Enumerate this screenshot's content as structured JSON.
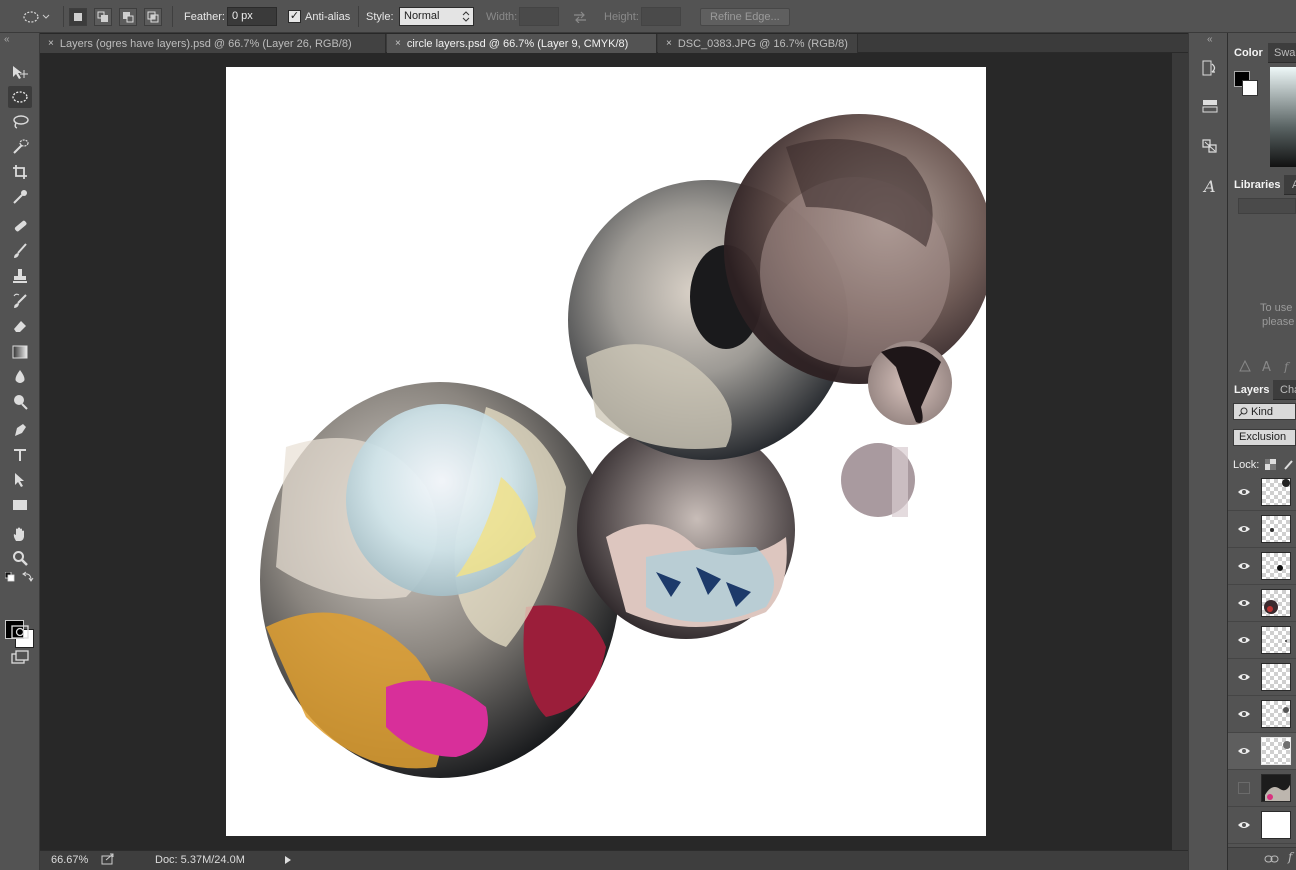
{
  "options_bar": {
    "feather_label": "Feather:",
    "feather_value": "0 px",
    "antialias_label": "Anti-alias",
    "style_label": "Style:",
    "style_value": "Normal",
    "width_label": "Width:",
    "height_label": "Height:",
    "refine_edge_label": "Refine Edge..."
  },
  "tabs": [
    {
      "label": "Layers (ogres have layers).psd @ 66.7% (Layer 26, RGB/8)",
      "active": false
    },
    {
      "label": "circle layers.psd @ 66.7% (Layer 9, CMYK/8)",
      "active": true
    },
    {
      "label": "DSC_0383.JPG @ 16.7% (RGB/8)",
      "active": false
    }
  ],
  "tab_close_glyph": "×",
  "collapse_glyph": "«",
  "status_bar": {
    "zoom": "66.67%",
    "doc": "Doc: 5.37M/24.0M"
  },
  "panels": {
    "color_tab": "Color",
    "swatches_tab": "Swa",
    "libraries_tab": "Libraries",
    "libraries_tab2": "A",
    "libraries_hint_1": "To use",
    "libraries_hint_2": "please",
    "layers_tab": "Layers",
    "channels_tab": "Cha",
    "filter_kind": "Kind",
    "blend_mode": "Exclusion",
    "lock_label": "Lock:"
  },
  "layers": [
    {
      "thumb": "transparent",
      "visible": true,
      "selected": false
    },
    {
      "thumb": "transparent",
      "visible": true,
      "selected": false
    },
    {
      "thumb": "transparent",
      "visible": true,
      "selected": false
    },
    {
      "thumb": "transparent",
      "visible": true,
      "selected": false
    },
    {
      "thumb": "transparent",
      "visible": true,
      "selected": false
    },
    {
      "thumb": "transparent",
      "visible": true,
      "selected": false
    },
    {
      "thumb": "transparent",
      "visible": true,
      "selected": false
    },
    {
      "thumb": "transparent",
      "visible": true,
      "selected": true
    },
    {
      "thumb": "photo",
      "visible": false,
      "selected": false
    },
    {
      "thumb": "white",
      "visible": true,
      "selected": false
    }
  ],
  "tools": [
    "move-tool",
    "elliptical-marquee-tool",
    "lasso-tool",
    "quick-selection-tool",
    "crop-tool",
    "eyedropper-tool",
    "spot-healing-tool",
    "brush-tool",
    "clone-stamp-tool",
    "history-brush-tool",
    "eraser-tool",
    "gradient-tool",
    "blur-tool",
    "dodge-tool",
    "pen-tool",
    "type-tool",
    "path-selection-tool",
    "rectangle-tool",
    "hand-tool",
    "zoom-tool"
  ],
  "colors": {
    "ui_bg": "#535353",
    "workspace": "#282828",
    "canvas": "#ffffff",
    "foreground": "#000000",
    "background": "#ffffff"
  }
}
